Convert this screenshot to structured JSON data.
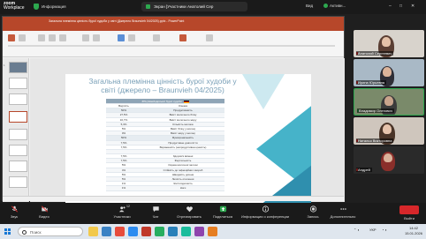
{
  "zoom": {
    "brand_line1": "zoom",
    "brand_line2": "Workplace",
    "info_label": "Информация",
    "share_text": "Экран [Участники Анатолий Сер",
    "view_label": "Вид",
    "status_label": "Активн...",
    "colors": {
      "green": "#2da84f",
      "end": "#d7272a"
    }
  },
  "powerpoint": {
    "title": "Загальна племінна цінність бурої худоби у світі (Джерело Braunvieh 04/2025).pptx - PowerPoint",
    "accent_color": "#b7472a",
    "slide_title": "Загальна племінна цінність бурої худоби у світі (джерело – Braunvieh 04/2025)",
    "table": {
      "header": "ЗПЦ Швейцарської бурої худоби",
      "col1": "Вартість",
      "col2": "Ознака",
      "rows": [
        {
          "c1": "50%",
          "c2": "Продуктивність",
          "type": "sub"
        },
        {
          "c1": "27,5%",
          "c2": "Вміст молочного білку"
        },
        {
          "c1": "16,7%",
          "c2": "Вміст молочного жиру"
        },
        {
          "c1": "5,3%",
          "c2": "Кількість молока"
        },
        {
          "c1": "5%",
          "c2": "Вміст білку у молоці"
        },
        {
          "c1": "0%",
          "c2": "Вміст жиру у молоці"
        },
        {
          "c1": "50%",
          "c2": "Функціональність",
          "type": "sub"
        },
        {
          "c1": "7,5%",
          "c2": "Продуктивне довголіття"
        },
        {
          "c1": "7,5%",
          "c2": "Вираженість (непродуктивна цінність)"
        },
        {
          "c1": "",
          "c2": ""
        },
        {
          "c1": "7,5%",
          "c2": "Здоров'я вимені"
        },
        {
          "c1": "7,5%",
          "c2": "Фертильність"
        },
        {
          "c1": "5%",
          "c2": "Оцінка молочної залози"
        },
        {
          "c1": "4%",
          "c2": "Стійкість до інфекційних хвороб"
        },
        {
          "c1": "5%",
          "c2": "Швидкість доїння"
        },
        {
          "c1": "5%",
          "c2": "Легкість отелення"
        },
        {
          "c1": "1%",
          "c2": "Життєздатність"
        },
        {
          "c1": "1%",
          "c2": "Ноги"
        }
      ]
    }
  },
  "participants": [
    {
      "name": "Анатолий Сергеевич"
    },
    {
      "name": "Ирина Юрьевна"
    },
    {
      "name": "Владимир Олегович"
    },
    {
      "name": "Наталья Викторовна"
    },
    {
      "name": "Андрей"
    }
  ],
  "toolbar": {
    "audio": "Звук",
    "video": "Видео",
    "participants": "Участники",
    "participants_count": "12",
    "chat": "Чат",
    "react": "Отреагировать",
    "share": "Поделиться",
    "info": "Информация о конференции",
    "record": "Запись",
    "more": "Дополнительно",
    "end": "Выйти"
  },
  "taskbar": {
    "search_placeholder": "Поиск",
    "lang": "УКР",
    "time": "14:42",
    "date": "15.01.2026"
  }
}
